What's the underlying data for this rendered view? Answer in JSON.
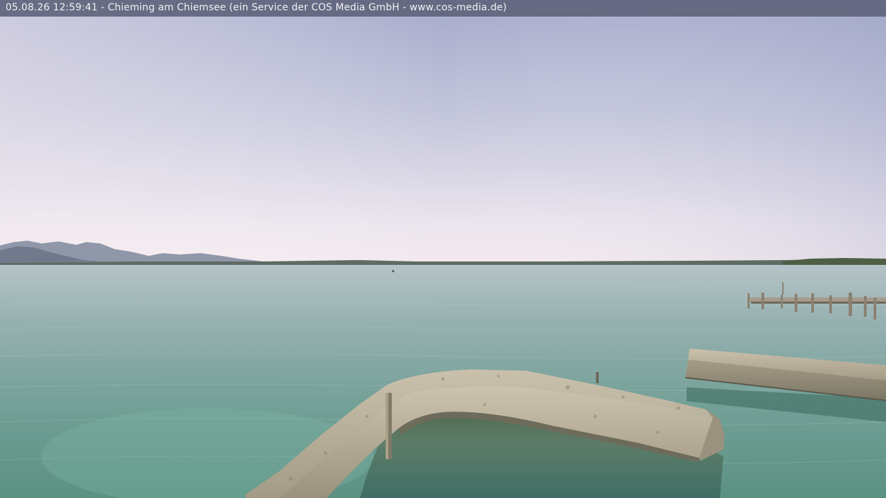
{
  "overlay": {
    "timestamp": "05.08.26 12:59:41",
    "caption": " - Chieming am Chiemsee (ein Service der COS Media GmbH - www.cos-media.de)"
  },
  "scene": {
    "colors": {
      "sky_top": "#a6abcb",
      "sky_horizon": "#f1e7ec",
      "water_far": "#a9bcc0",
      "water_near": "#5e8f83",
      "stone": "#b3ab97",
      "stone_dark": "#8a8371",
      "mountains": "#6f7687"
    }
  }
}
